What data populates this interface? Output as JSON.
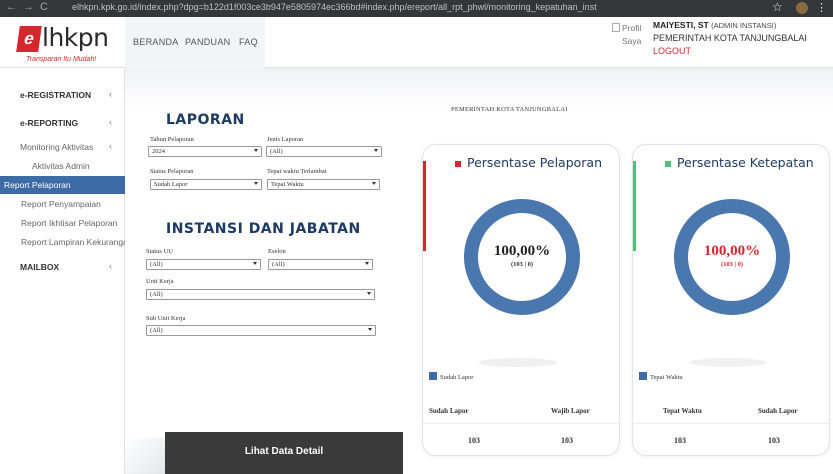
{
  "browser": {
    "url": "elhkpn.kpk.go.id/index.php?dpg=b122d1f003ce3b947e5805974ec366bd#index.php/ereport/all_rpt_phwl/monitoring_kepatuhan_inst"
  },
  "header": {
    "logo_text_e": "e",
    "logo_text": "lhkpn",
    "logo_tagline": "Transparan Itu Mudah!",
    "nav": [
      "BERANDA",
      "PANDUAN",
      "FAQ"
    ],
    "user_photo_alt_1": "Profil",
    "user_photo_alt_2": "Saya",
    "user_name": "MAIYESTI, ST",
    "user_role": "(ADMIN INSTANSI)",
    "user_org": "PEMERINTAH KOTA TANJUNGBALAI",
    "logout": "LOGOUT"
  },
  "sidebar": {
    "items": [
      {
        "label": "e-REGISTRATION",
        "chevron": "‹"
      },
      {
        "label": "e-REPORTING",
        "chevron": "‹"
      },
      {
        "label": "Monitoring Aktivitas",
        "chevron": "‹"
      },
      {
        "label": "Aktivitas Admin"
      },
      {
        "label": "Report Pelaporan"
      },
      {
        "label": "Report Penyampaian"
      },
      {
        "label": "Report Ikhtisar Pelaporan"
      },
      {
        "label": "Report Lampiran Kekurangan"
      },
      {
        "label": "MAILBOX",
        "chevron": "‹"
      }
    ]
  },
  "main": {
    "org_heading": "PEMERINTAH KOTA TANJUNGBALAI",
    "laporan_title": "LAPORAN",
    "instansi_title": "INSTANSI DAN JABATAN",
    "filters": {
      "tahun_label": "Tahun Pelaporan",
      "tahun_value": "2024",
      "jenis_label": "Jenis Laporan",
      "jenis_value": "(All)",
      "status_label": "Status Pelaporan",
      "status_value": "Sudah Lapor",
      "tepat_label": "Tepat waktu Terlambat",
      "tepat_value": "Tepat Waktu",
      "statusuu_label": "Status UU",
      "statusuu_value": "(All)",
      "eselon_label": "Eselon",
      "eselon_value": "(All)",
      "unit_label": "Unit Kerja",
      "unit_value": "(All)",
      "subunit_label": "Sub Unit Kerja",
      "subunit_value": "(All)"
    },
    "detail_button": "Lihat Data Detail"
  },
  "cards": [
    {
      "title": "Persentase Pelaporan",
      "accent": "#d7262e",
      "percent_text": "100,00%",
      "ratio_text": "(103 | 0)",
      "percent_color": "#222222",
      "fraction": 1.0,
      "legend": "Sudah Lapor",
      "col1_header": "Sudah Lapor",
      "col2_header": "Wajib Lapor",
      "col1_value": "103",
      "col2_value": "103"
    },
    {
      "title": "Persentase Ketepatan",
      "accent": "#4fc07a",
      "percent_text": "100,00%",
      "ratio_text": "(103 | 0)",
      "percent_color": "#d7262e",
      "fraction": 1.0,
      "legend": "Tepat Waktu",
      "col1_header": "Tepat Waktu",
      "col2_header": "Sudah Lapor",
      "col1_value": "103",
      "col2_value": "103"
    }
  ],
  "colors": {
    "donut": "#4a77ad",
    "sidebar_active": "#3d6ba5",
    "brand_red": "#d7262e"
  }
}
